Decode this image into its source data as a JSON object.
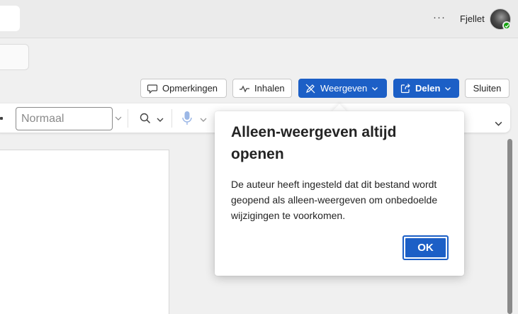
{
  "titlebar": {
    "more_label": "···",
    "username": "Fjellet",
    "avatar_icon": "user-avatar",
    "presence_icon": "available-check-icon",
    "presence_color": "#13a10e"
  },
  "actions": {
    "comments_label": "Opmerkingen",
    "catchup_label": "Inhalen",
    "view_label": "Weergeven",
    "share_label": "Delen",
    "close_label": "Sluiten"
  },
  "ribbon": {
    "style_placeholder": "Normaal"
  },
  "callout": {
    "title": "Alleen-weergeven altijd openen",
    "body": "De auteur heeft ingesteld dat dit bestand wordt geopend als alleen-weergeven om onbedoelde wijzigingen te voorkomen.",
    "ok_label": "OK"
  },
  "colors": {
    "accent": "#1c5fc6",
    "background": "#f0f0f0"
  }
}
